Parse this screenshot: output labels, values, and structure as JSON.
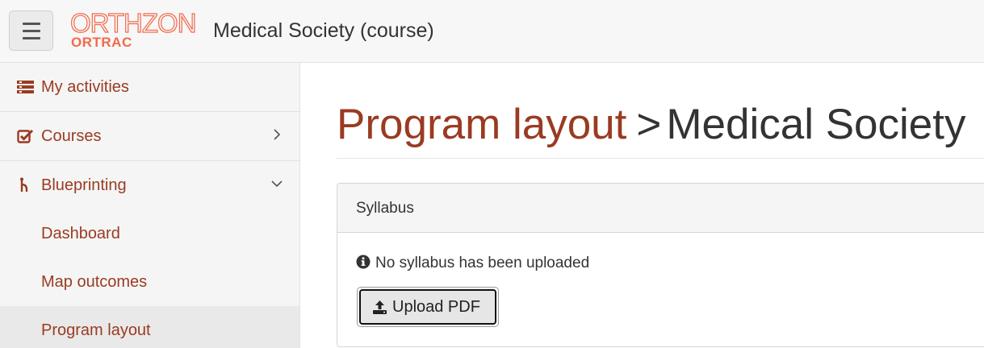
{
  "header": {
    "menu_icon": "hamburger-menu-icon",
    "logo_top_text": "ORTHZONE",
    "logo_bottom_text": "ORTRAC",
    "title": "Medical Society (course)"
  },
  "sidebar": {
    "items": [
      {
        "label": "My activities",
        "icon": "list-icon"
      },
      {
        "label": "Courses",
        "icon": "checkbox-icon",
        "chevron": "chevron-right-icon"
      },
      {
        "label": "Blueprinting",
        "icon": "blueprint-branch-icon",
        "chevron": "chevron-down-icon"
      }
    ],
    "sub_items": [
      {
        "label": "Dashboard"
      },
      {
        "label": "Map outcomes"
      },
      {
        "label": "Program layout",
        "active": true
      }
    ]
  },
  "main": {
    "breadcrumb": {
      "parent": "Program layout",
      "separator": ">",
      "current": "Medical Society"
    },
    "syllabus_panel": {
      "title": "Syllabus",
      "notice": "No syllabus has been uploaded",
      "notice_icon": "info-circle-icon",
      "upload_button_label": "Upload PDF",
      "upload_icon": "upload-icon"
    }
  },
  "colors": {
    "accent": "#9a3b22",
    "logo": "#f26a4b",
    "sidebar_bg": "#f5f5f5",
    "active_item_bg": "#e9e9e9"
  }
}
